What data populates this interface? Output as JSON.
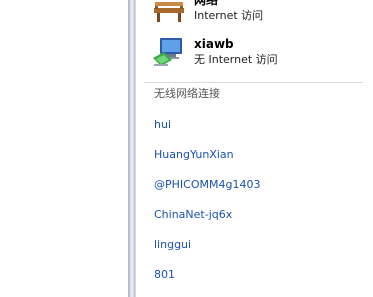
{
  "connections": [
    {
      "name": "网络",
      "status": "Internet 访问",
      "icon": "network-bench-icon"
    },
    {
      "name": "xiawb",
      "status": "无 Internet 访问",
      "icon": "network-computer-icon"
    }
  ],
  "wireless": {
    "heading": "无线网络连接",
    "networks": [
      {
        "ssid": "hui"
      },
      {
        "ssid": "HuangYunXian"
      },
      {
        "ssid": "@PHICOMM4g1403"
      },
      {
        "ssid": "ChinaNet-jq6x"
      },
      {
        "ssid": "linggui"
      },
      {
        "ssid": "801"
      }
    ]
  },
  "colors": {
    "link": "#1a51b0",
    "heading": "#555555",
    "separator": "#d4dbe2"
  }
}
